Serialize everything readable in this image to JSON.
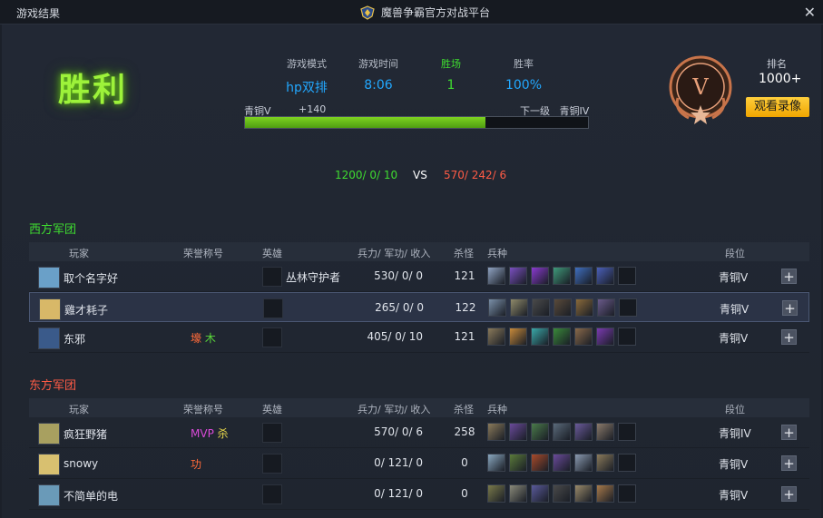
{
  "window": {
    "left_title": "游戏结果",
    "center_title": "魔兽争霸官方对战平台",
    "close": "✕"
  },
  "result": {
    "label": "胜利"
  },
  "stats": [
    {
      "label": "游戏模式",
      "value": "hp双排"
    },
    {
      "label": "游戏时间",
      "value": "8:06"
    },
    {
      "label": "胜场",
      "value": "1"
    },
    {
      "label": "胜率",
      "value": "100%"
    }
  ],
  "progress": {
    "current": "青铜V",
    "gain": "+140",
    "next_label": "下一级",
    "next": "青铜IV",
    "fraction": 0.7
  },
  "ranking": {
    "label": "排名",
    "value": "1000+",
    "replay": "观看录像",
    "medal_letter": "V"
  },
  "score": {
    "west": "1200/ 0/ 10",
    "vs": "VS",
    "east": "570/ 242/ 6"
  },
  "headers": {
    "player": "玩家",
    "honor": "荣誉称号",
    "hero": "英雄",
    "force": "兵力/ 军功/ 收入",
    "kills": "杀怪",
    "units": "兵种",
    "rank": "段位"
  },
  "west": {
    "title": "西方军团",
    "rows": [
      {
        "name": "取个名字好",
        "honor": "",
        "hero": "丛林守护者",
        "force": "530/ 0/ 0",
        "kills": "121",
        "rank": "青铜V",
        "avatar": "#6aa0c8",
        "units": [
          "#8fa3c2",
          "#7a4fc0",
          "#8a3ad0",
          "#3f9a7a",
          "#3f6fc0",
          "#4a5fb8"
        ]
      },
      {
        "name": "雞才耗子",
        "honor": "",
        "hero": "",
        "force": "265/ 0/ 0",
        "kills": "122",
        "rank": "青铜V",
        "avatar": "#d8b868",
        "units": [
          "#7a8fa8",
          "#8f8a6a",
          "#4a4a4a",
          "#5a4a3a",
          "#8a6a3a",
          "#6a5a8a"
        ]
      },
      {
        "name": "东邪",
        "honor": "壕 木",
        "hero": "",
        "force": "405/ 0/ 10",
        "kills": "121",
        "rank": "青铜V",
        "avatar": "#3a5a8a",
        "units": [
          "#8a7a5a",
          "#c88a3a",
          "#3aa8a8",
          "#3a8a3a",
          "#8a6a4a",
          "#7a3ab0"
        ]
      }
    ]
  },
  "east": {
    "title": "东方军团",
    "rows": [
      {
        "name": "疯狂野猪",
        "honor": "MVP 杀",
        "hero": "",
        "force": "570/ 0/ 6",
        "kills": "258",
        "rank": "青铜IV",
        "avatar": "#a8a060",
        "units": [
          "#8a7a5a",
          "#6a4a9a",
          "#4a7a4a",
          "#5a6a7a",
          "#6a5a9a",
          "#8a7a6a"
        ]
      },
      {
        "name": "snowy",
        "honor": "功",
        "hero": "",
        "force": "0/ 121/ 0",
        "kills": "0",
        "rank": "青铜V",
        "avatar": "#d8c070",
        "units": [
          "#8aa8c0",
          "#5a7a3a",
          "#a84a2a",
          "#6a4a9a",
          "#8a9ab0",
          "#8a7a5a"
        ]
      },
      {
        "name": "不简单的电",
        "honor": "",
        "hero": "",
        "force": "0/ 121/ 0",
        "kills": "0",
        "rank": "青铜V",
        "avatar": "#6a9ab8",
        "units": [
          "#7a7a4a",
          "#8a8a7a",
          "#5a5a9a",
          "#4a4a4a",
          "#9a8a6a",
          "#a87a4a"
        ]
      }
    ]
  }
}
